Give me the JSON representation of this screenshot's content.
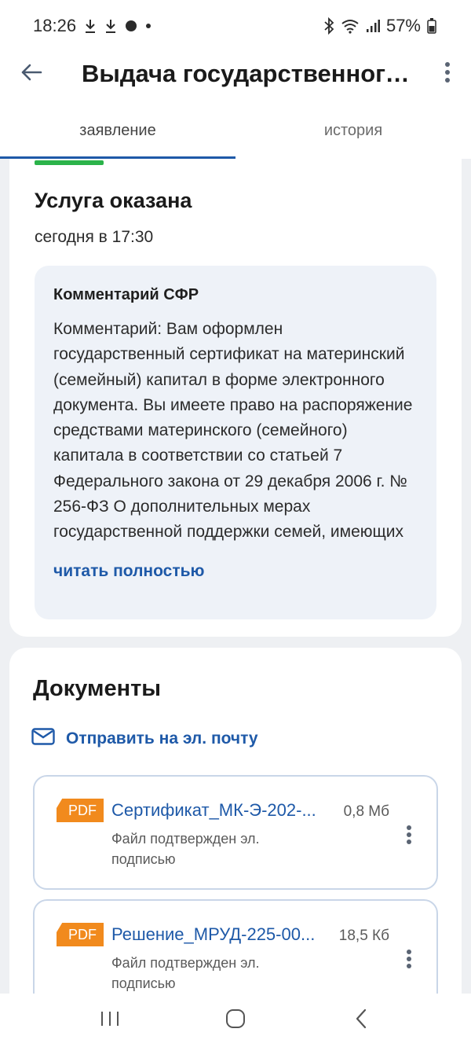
{
  "status_bar": {
    "time": "18:26",
    "battery": "57%",
    "icons": [
      "download-icon",
      "download-icon",
      "notification-dot-icon",
      "dot-icon",
      "bluetooth-icon",
      "wifi-icon",
      "signal-icon",
      "battery-icon"
    ]
  },
  "app_bar": {
    "title": "Выдача государственного сертификата на материнский (семейный) капитал",
    "back_icon": "arrow-left-icon",
    "more_icon": "more-vertical-icon"
  },
  "tabs": [
    {
      "label": "заявление",
      "active": true
    },
    {
      "label": "история",
      "active": false
    }
  ],
  "status_card": {
    "title": "Услуга оказана",
    "time": "сегодня в 17:30",
    "comment": {
      "title": "Комментарий СФР",
      "text": "Комментарий: Вам оформлен государственный сертификат на материнский (семейный) капитал в форме электронного документа. Вы имеете право на распоряжение средствами материнского (семейного) капитала в соответствии со статьей 7 Федерального закона от 29 декабря 2006 г. № 256-ФЗ О дополнительных мерах государственной поддержки семей, имеющих детей. Под...",
      "read_more": "читать полностью"
    }
  },
  "documents": {
    "title": "Документы",
    "email_link": "Отправить на эл. почту",
    "email_icon": "mail-icon",
    "items": [
      {
        "badge": "PDF",
        "name": "Сертификат_МК-Э-202-...",
        "size": "0,8 Мб",
        "subtitle": "Файл подтвержден эл. подписью"
      },
      {
        "badge": "PDF",
        "name": "Решение_МРУД-225-00...",
        "size": "18,5 Кб",
        "subtitle": "Файл подтвержден эл. подписью"
      }
    ]
  },
  "nav_bar": {
    "buttons": [
      "recent-apps-icon",
      "home-icon",
      "back-icon"
    ]
  },
  "colors": {
    "accent": "#1e59a8",
    "success": "#2bb34a",
    "pdf_badge": "#f18a1d",
    "background": "#eef0f3"
  }
}
